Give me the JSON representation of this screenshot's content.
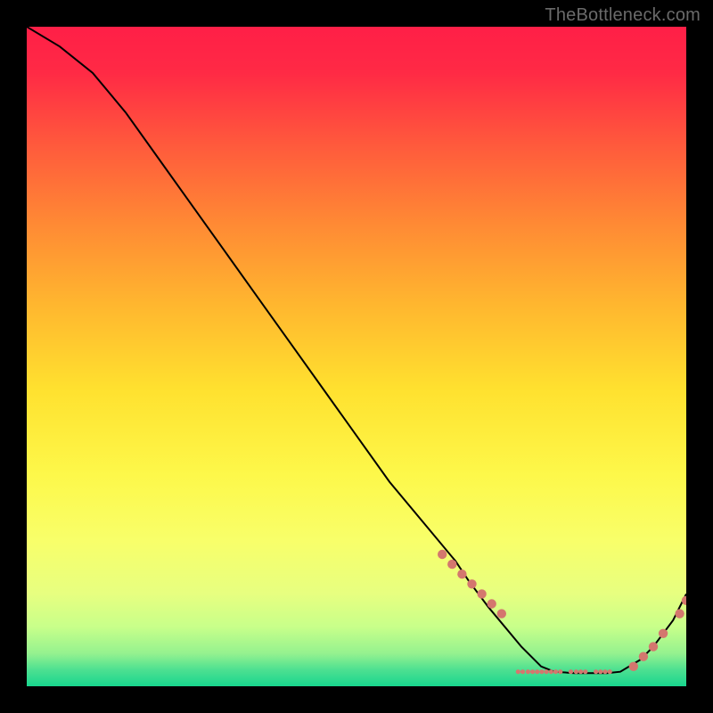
{
  "watermark": "TheBottleneck.com",
  "chart_data": {
    "type": "line",
    "title": "",
    "xlabel": "",
    "ylabel": "",
    "xlim": [
      0,
      100
    ],
    "ylim": [
      0,
      100
    ],
    "grid": false,
    "legend": false,
    "series": [
      {
        "name": "curve",
        "x": [
          0,
          5,
          10,
          15,
          20,
          25,
          30,
          35,
          40,
          45,
          50,
          55,
          60,
          65,
          67,
          70,
          75,
          78,
          80,
          83,
          85,
          88,
          90,
          93,
          95,
          98,
          100
        ],
        "y": [
          100,
          97,
          93,
          87,
          80,
          73,
          66,
          59,
          52,
          45,
          38,
          31,
          25,
          19,
          16,
          12,
          6,
          3,
          2.2,
          2,
          2,
          2,
          2.2,
          4,
          6,
          10,
          14
        ]
      }
    ],
    "marker_clusters": [
      {
        "name": "left-drop",
        "color": "#d4776e",
        "points": [
          {
            "x": 63,
            "y": 20
          },
          {
            "x": 64.5,
            "y": 18.5
          },
          {
            "x": 66,
            "y": 17
          },
          {
            "x": 67.5,
            "y": 15.5
          },
          {
            "x": 69,
            "y": 14
          },
          {
            "x": 70.5,
            "y": 12.5
          },
          {
            "x": 72,
            "y": 11
          }
        ]
      },
      {
        "name": "right-rise",
        "color": "#d4776e",
        "points": [
          {
            "x": 92,
            "y": 3
          },
          {
            "x": 93.5,
            "y": 4.5
          },
          {
            "x": 95,
            "y": 6
          },
          {
            "x": 96.5,
            "y": 8
          },
          {
            "x": 99,
            "y": 11
          },
          {
            "x": 100,
            "y": 13
          }
        ]
      },
      {
        "name": "bottom-dashes",
        "color": "#d4776e",
        "points": [
          {
            "x": 74.5,
            "y": 2.2
          },
          {
            "x": 75.2,
            "y": 2.2
          },
          {
            "x": 76.0,
            "y": 2.2
          },
          {
            "x": 76.7,
            "y": 2.2
          },
          {
            "x": 77.4,
            "y": 2.2
          },
          {
            "x": 78.1,
            "y": 2.2
          },
          {
            "x": 78.8,
            "y": 2.2
          },
          {
            "x": 79.5,
            "y": 2.2
          },
          {
            "x": 80.2,
            "y": 2.2
          },
          {
            "x": 80.9,
            "y": 2.2
          },
          {
            "x": 82.5,
            "y": 2.2
          },
          {
            "x": 83.3,
            "y": 2.2
          },
          {
            "x": 84.0,
            "y": 2.2
          },
          {
            "x": 84.7,
            "y": 2.2
          },
          {
            "x": 86.3,
            "y": 2.2
          },
          {
            "x": 87.0,
            "y": 2.2
          },
          {
            "x": 87.7,
            "y": 2.2
          },
          {
            "x": 88.4,
            "y": 2.2
          }
        ]
      }
    ],
    "gradient_stops": [
      {
        "offset": 0.0,
        "color": "#ff1f47"
      },
      {
        "offset": 0.07,
        "color": "#ff2a45"
      },
      {
        "offset": 0.18,
        "color": "#ff5a3c"
      },
      {
        "offset": 0.3,
        "color": "#ff8a34"
      },
      {
        "offset": 0.42,
        "color": "#ffb62f"
      },
      {
        "offset": 0.55,
        "color": "#ffe12f"
      },
      {
        "offset": 0.68,
        "color": "#fdf84a"
      },
      {
        "offset": 0.78,
        "color": "#f8ff6a"
      },
      {
        "offset": 0.86,
        "color": "#e7ff80"
      },
      {
        "offset": 0.91,
        "color": "#c8ff8a"
      },
      {
        "offset": 0.95,
        "color": "#95f28f"
      },
      {
        "offset": 0.975,
        "color": "#4de091"
      },
      {
        "offset": 1.0,
        "color": "#18d68e"
      }
    ]
  }
}
